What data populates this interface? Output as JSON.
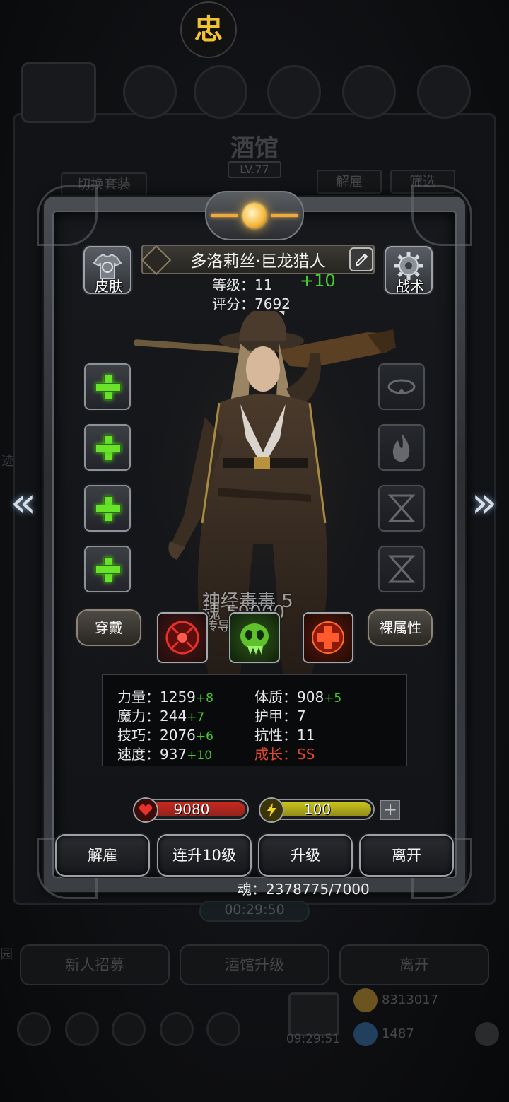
{
  "top_badge": {
    "glyph": "忠"
  },
  "background": {
    "title": "酒馆",
    "level": "LV.77",
    "switch_outfit": "切换套装",
    "dismiss": "解雇",
    "filter": "筛选",
    "timer": "00:29:50",
    "new_recruit": "新人招募",
    "tavern_upgrade": "酒馆升级",
    "leave": "离开",
    "gift_timer": "09:29:51",
    "gold": "8313017",
    "gems": "1487",
    "side_fragment": "迹",
    "side_fragment2": "园"
  },
  "hero": {
    "name": "多洛莉丝·巨龙猎人",
    "level_text": "等级：11",
    "level_bonus": "+10",
    "score_text": "评分：7692",
    "skin_label": "皮肤",
    "tactics_label": "战术"
  },
  "buttons": {
    "wear": "穿戴",
    "naked_attr": "裸属性"
  },
  "overlay": {
    "line1": "神经毒毒 5",
    "line2": "魂 59000",
    "line3": "传导专精 - I"
  },
  "stats": {
    "left": [
      {
        "label": "力量：1259",
        "bonus": "+8"
      },
      {
        "label": "魔力：244",
        "bonus": "+7"
      },
      {
        "label": "技巧：2076",
        "bonus": "+6"
      },
      {
        "label": "速度：937",
        "bonus": "+10"
      }
    ],
    "right": [
      {
        "label": "体质：908",
        "bonus": "+5"
      },
      {
        "label": "护甲：7",
        "bonus": ""
      },
      {
        "label": "抗性：11",
        "bonus": ""
      },
      {
        "label": "成长：SS",
        "bonus": ""
      }
    ]
  },
  "bars": {
    "hp": {
      "value": "9080",
      "fill": 1.0,
      "color": "#c8281e"
    },
    "energy": {
      "value": "100",
      "fill": 1.0,
      "color": "#c9c21c"
    }
  },
  "actions": {
    "dismiss": "解雇",
    "level_up_10": "连升10级",
    "level_up": "升级",
    "leave": "离开"
  },
  "soul_text": "魂：2378775/7000",
  "colors": {
    "accent_green": "#44d12d",
    "growth_red": "#e2492c",
    "panel_border": "#9da1a7"
  }
}
